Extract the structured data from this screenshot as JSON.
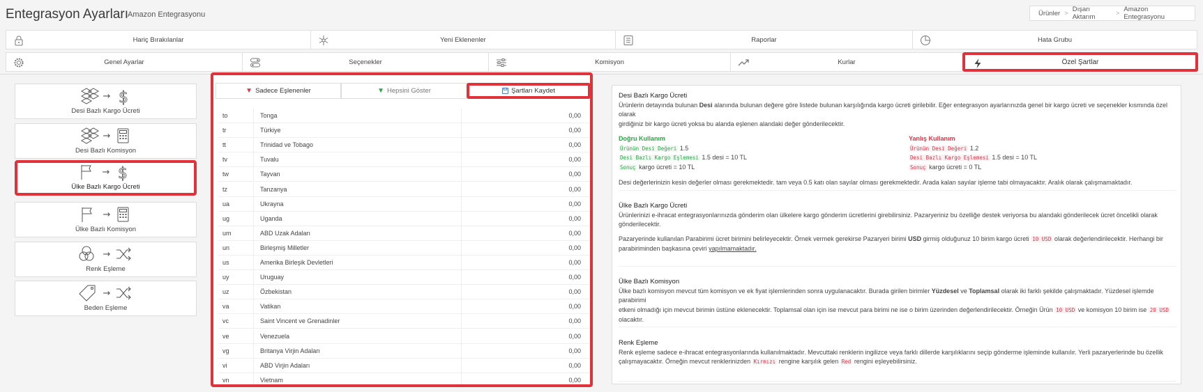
{
  "page": {
    "title": "Entegrasyon Ayarları",
    "subtitle": "Amazon Entegrasyonu",
    "breadcrumb": {
      "items": [
        "Ürünler",
        "Dışarı Aktarım",
        "Amazon Entegrasyonu"
      ],
      "separator": ">"
    }
  },
  "tabs": {
    "row1": [
      "Hariç Bırakılanlar",
      "Yeni Eklenenler",
      "Raporlar",
      "Hata Grubu"
    ],
    "row2": [
      "Genel Ayarlar",
      "Seçenekler",
      "Komisyon",
      "Kurlar",
      "Özel Şartlar"
    ],
    "active": "Özel Şartlar"
  },
  "left_menu": {
    "items": [
      {
        "label": "Desi Bazlı Kargo Ücreti",
        "icons": [
          "boxes-icon",
          "arrow-right",
          "dollar-icon"
        ]
      },
      {
        "label": "Desi Bazlı Komisyon",
        "icons": [
          "boxes-icon",
          "arrow-right",
          "calculator-icon"
        ]
      },
      {
        "label": "Ülke Bazlı Kargo Ücreti",
        "icons": [
          "flag-icon",
          "arrow-right",
          "dollar-icon"
        ]
      },
      {
        "label": "Ülke Bazlı Komisyon",
        "icons": [
          "flag-icon",
          "arrow-right",
          "calculator-icon"
        ]
      },
      {
        "label": "Renk Eşleme",
        "icons": [
          "colors-icon",
          "arrow-right",
          "shuffle-icon"
        ]
      },
      {
        "label": "Beden Eşleme",
        "icons": [
          "tag-icon",
          "arrow-right",
          "shuffle-icon"
        ]
      }
    ],
    "arrow": "→",
    "active_index": 2
  },
  "toolbar": {
    "filter_matched": "Sadece Eşlenenler",
    "show_all": "Hepsini Göster",
    "save": "Şartları Kaydet"
  },
  "countries": {
    "rows": [
      {
        "code": "to",
        "name": "Tonga",
        "value": "0,00"
      },
      {
        "code": "tr",
        "name": "Türkiye",
        "value": "0,00"
      },
      {
        "code": "tt",
        "name": "Trinidad ve Tobago",
        "value": "0,00"
      },
      {
        "code": "tv",
        "name": "Tuvalu",
        "value": "0,00"
      },
      {
        "code": "tw",
        "name": "Tayvan",
        "value": "0,00"
      },
      {
        "code": "tz",
        "name": "Tanzanya",
        "value": "0,00"
      },
      {
        "code": "ua",
        "name": "Ukrayna",
        "value": "0,00"
      },
      {
        "code": "ug",
        "name": "Uganda",
        "value": "0,00"
      },
      {
        "code": "um",
        "name": "ABD Uzak Adaları",
        "value": "0,00"
      },
      {
        "code": "un",
        "name": "Birleşmiş Milletler",
        "value": "0,00"
      },
      {
        "code": "us",
        "name": "Amerika Birleşik Devletleri",
        "value": "0,00"
      },
      {
        "code": "uy",
        "name": "Uruguay",
        "value": "0,00"
      },
      {
        "code": "uz",
        "name": "Özbekistan",
        "value": "0,00"
      },
      {
        "code": "va",
        "name": "Vatikan",
        "value": "0,00"
      },
      {
        "code": "vc",
        "name": "Saint Vincent ve Grenadinler",
        "value": "0,00"
      },
      {
        "code": "ve",
        "name": "Venezuela",
        "value": "0,00"
      },
      {
        "code": "vg",
        "name": "Britanya Virjin Adaları",
        "value": "0,00"
      },
      {
        "code": "vi",
        "name": "ABD Virjin Adaları",
        "value": "0,00"
      },
      {
        "code": "vn",
        "name": "Vietnam",
        "value": "0,00"
      }
    ]
  },
  "help": {
    "desi": {
      "title": "Desi Bazlı Kargo Ücreti",
      "text_a": "Ürünlerin detayında bulunan ",
      "text_bold": "Desi",
      "text_b": " alanında bulunan değere göre listede bulunan karşılığında kargo ücreti girilebilir. Eğer entegrasyon ayarlarınızda genel bir kargo ücreti ve seçenekler kısmında özel olarak",
      "text_c": "girdiğiniz bir kargo ücreti yoksa bu alanda eşlenen alandaki değer gönderilecektir.",
      "correct_title": "Doğru Kullanım",
      "wrong_title": "Yanlış Kullanım",
      "code_product_desi": "Ürünün Desi Değeri",
      "code_mapping": "Desi Bazlı Kargo Eşlemesi",
      "code_result": "Sonuç",
      "correct_desi": "1.5",
      "correct_map": "1.5 desi = 10 TL",
      "correct_result": "kargo ücreti = 10 TL",
      "wrong_desi": "1.2",
      "wrong_map": "1.5 desi = 10 TL",
      "wrong_result": "kargo ücreti = 0 TL",
      "note": "Desi değerlerinizin kesin değerler olması gerekmektedir. tam veya 0.5 katı olan sayılar olması gerekmektedir. Arada kalan sayılar işleme tabi olmayacaktır. Aralık olarak çalışmamaktadır."
    },
    "country_cargo": {
      "title": "Ülke Bazlı Kargo Ücreti",
      "p1a": "Ürünlerinizi e-ihracat entegrasyonlarınızda gönderim olan ülkelere kargo gönderim ücretlerini girebilirsiniz. Pazaryeriniz bu özelliğe destek veriyorsa bu alandaki gönderilecek ücret öncelikli olarak",
      "p1b": "gönderilecektir.",
      "p2a": "Pazaryerinde kullanılan Parabirimi ücret birimini belirleyecektir. Örnek vermek gerekirse Pazaryeri birimi ",
      "p2_bold": "USD",
      "p2b": " girmiş olduğunuz 10 birim kargo ücreti ",
      "p2_code": "10 USD",
      "p2c": " olarak değerlendirilecektir. Herhangi bir",
      "p2d": "parabiriminden başkasına çeviri ",
      "p2_link": "yapılmamaktadır."
    },
    "country_commission": {
      "title": "Ülke Bazlı Komisyon",
      "l1a": "Ülke bazlı komisyon mevcut tüm komisyon ve ek fiyat işlemlerinden sonra uygulanacaktır. Burada girilen birimler ",
      "l1_b1": "Yüzdesel",
      "l1_ve": " ve ",
      "l1_b2": "Toplamsal",
      "l1b": " olarak iki farklı şekilde çalışmaktadır. Yüzdesel işlemde parabirimi",
      "l2a": "etkeni olmadığı için mevcut birimin üstüne eklenecektir. Toplamsal olan için ise mevcut para birimi ne ise o birim üzerinden değerlendirilecektir. Örneğin Ürün ",
      "l2_code1": "10 USD",
      "l2b": " ve komisyon 10 birim ise ",
      "l2_code2": "20 USD",
      "l3": "olacaktır."
    },
    "color": {
      "title": "Renk Eşleme",
      "l1": "Renk eşleme sadece e-ihracat entegrasyonlarında kullanılmaktadır. Mevcuttaki renklerin ingilizce veya farklı dillerde karşılıklarını seçip gönderme işleminde kullanılır. Yerli pazaryerlerinde bu özellik",
      "l2a": "çalışmayacaktır. Örneğin mevcut renklerinizden ",
      "l2_code1": "Kırmızı",
      "l2b": " rengine karşılık gelen ",
      "l2_code2": "Red",
      "l2c": " rengini eşleyebilirsiniz."
    }
  },
  "colors": {
    "accent_red": "#e0323a",
    "green": "#28a745",
    "red": "#dc3545"
  }
}
